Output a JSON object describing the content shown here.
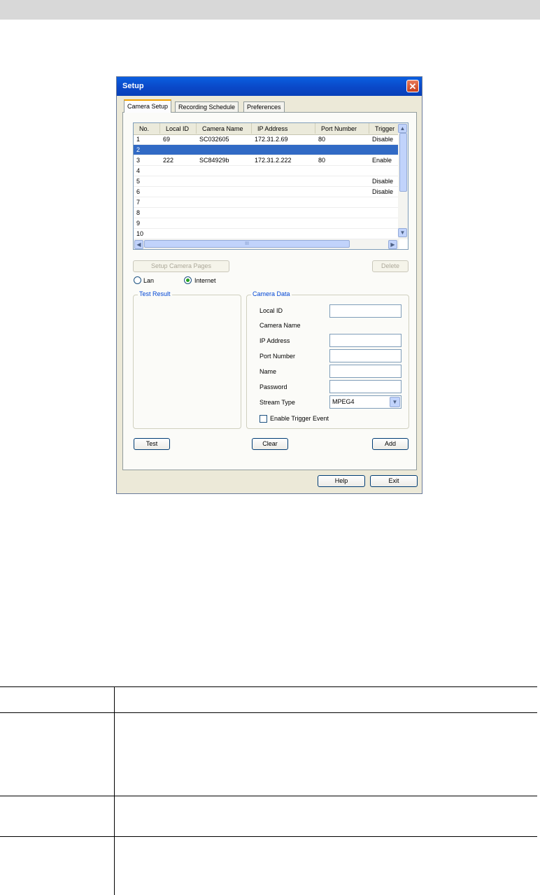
{
  "window": {
    "title": "Setup",
    "close_glyph": "✕"
  },
  "tabs": [
    {
      "label": "Camera Setup",
      "active": true
    },
    {
      "label": "Recording Schedule",
      "active": false
    },
    {
      "label": "Preferences",
      "active": false
    }
  ],
  "grid": {
    "columns": [
      "No.",
      "Local ID",
      "Camera Name",
      "IP Address",
      "Port Number",
      "Trigger"
    ],
    "rows": [
      [
        "1",
        "69",
        "SC032605",
        "172.31.2.69",
        "80",
        "Disable"
      ],
      [
        "2",
        "",
        "",
        "",
        "",
        ""
      ],
      [
        "3",
        "222",
        "SC84929b",
        "172.31.2.222",
        "80",
        "Enable"
      ],
      [
        "4",
        "",
        "",
        "",
        "",
        ""
      ],
      [
        "5",
        "",
        "",
        "",
        "",
        "Disable"
      ],
      [
        "6",
        "",
        "",
        "",
        "",
        "Disable"
      ],
      [
        "7",
        "",
        "",
        "",
        "",
        ""
      ],
      [
        "8",
        "",
        "",
        "",
        "",
        ""
      ],
      [
        "9",
        "",
        "",
        "",
        "",
        ""
      ],
      [
        "10",
        "",
        "",
        "",
        "",
        ""
      ]
    ],
    "selected_row": "2",
    "hscroll_grip": "III"
  },
  "buttons": {
    "setup_camera_pages": "Setup Camera Pages",
    "delete": "Delete",
    "test": "Test",
    "clear": "Clear",
    "add": "Add",
    "help": "Help",
    "exit": "Exit"
  },
  "connection": {
    "lan": "Lan",
    "internet": "Internet",
    "selected": "Internet"
  },
  "test_result": {
    "label": "Test Result"
  },
  "camera_data": {
    "label": "Camera Data",
    "local_id": "Local ID",
    "camera_name": "Camera Name",
    "ip_address": "IP Address",
    "port_number": "Port Number",
    "name": "Name",
    "password": "Password",
    "stream_type": "Stream Type",
    "stream_type_value": "MPEG4",
    "enable_trigger": "Enable Trigger Event",
    "enable_trigger_checked": false
  }
}
